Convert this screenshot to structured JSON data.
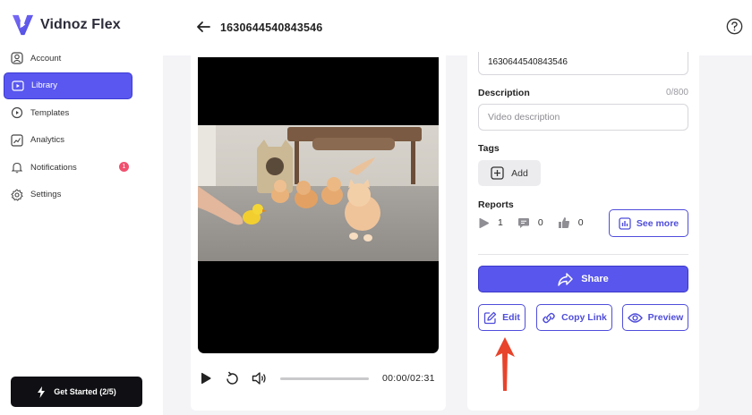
{
  "app": {
    "name": "Vidnoz Flex",
    "brand_color": "#5856ec"
  },
  "sidebar": {
    "items": [
      {
        "label": "Account",
        "icon": "user-icon",
        "active": false
      },
      {
        "label": "Library",
        "icon": "library-icon",
        "active": true
      },
      {
        "label": "Templates",
        "icon": "templates-icon",
        "active": false
      },
      {
        "label": "Analytics",
        "icon": "analytics-icon",
        "active": false
      },
      {
        "label": "Notifications",
        "icon": "bell-icon",
        "active": false,
        "badge": "1"
      },
      {
        "label": "Settings",
        "icon": "gear-icon",
        "active": false
      }
    ],
    "get_started": "Get Started (2/5)"
  },
  "header": {
    "title": "1630644540843546"
  },
  "player": {
    "time": "00:00/02:31",
    "progress": 0
  },
  "details": {
    "title_value": "1630644540843546",
    "description_label": "Description",
    "description_counter": "0/800",
    "description_placeholder": "Video description",
    "tags_label": "Tags",
    "add_tag": "Add",
    "reports_label": "Reports",
    "stats": {
      "views": "1",
      "comments": "0",
      "likes": "0"
    },
    "see_more": "See more",
    "share": "Share",
    "edit": "Edit",
    "copy_link": "Copy Link",
    "preview": "Preview"
  }
}
